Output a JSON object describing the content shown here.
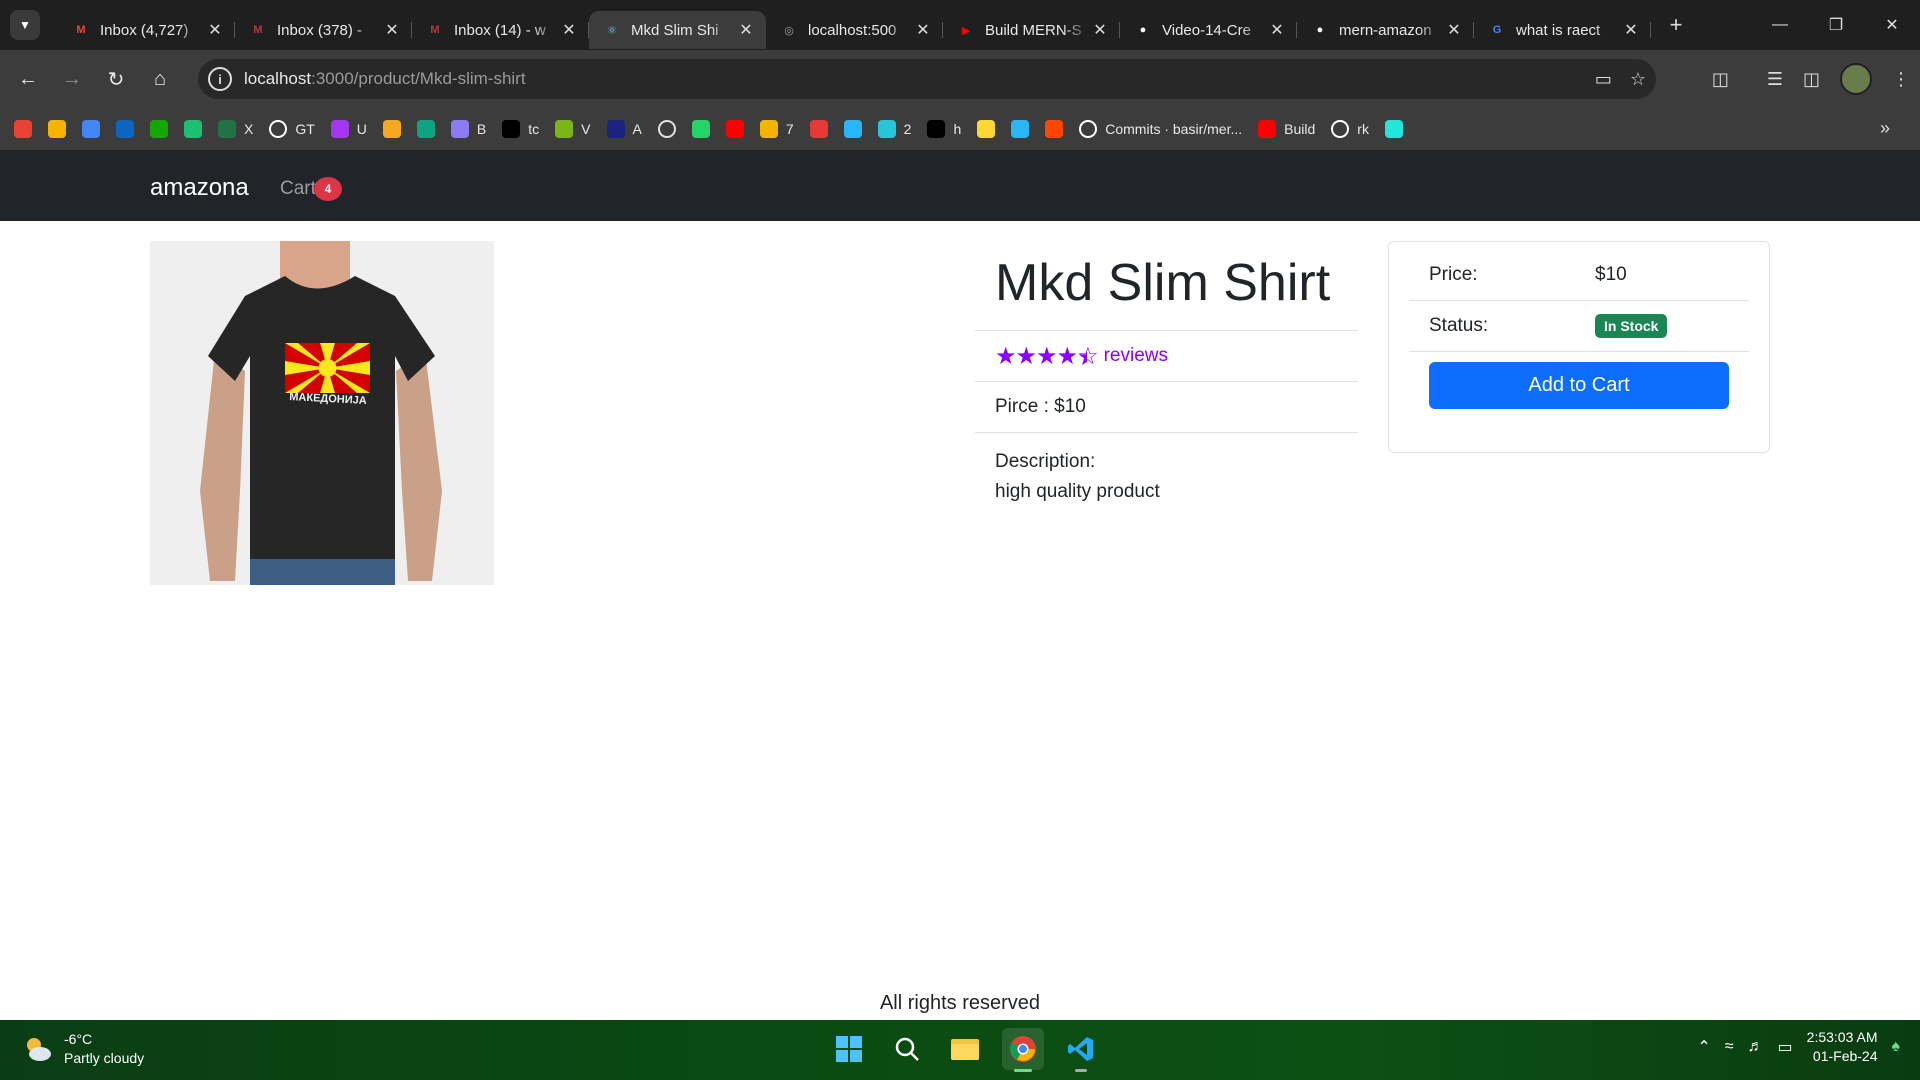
{
  "browser": {
    "tabs": [
      {
        "label": "Inbox (4,727)",
        "icon": "gmail-icon",
        "active": false
      },
      {
        "label": "Inbox (378) -",
        "icon": "mail-icon",
        "active": false
      },
      {
        "label": "Inbox (14) - w",
        "icon": "mail-icon",
        "active": false
      },
      {
        "label": "Mkd Slim Shi",
        "icon": "react-icon",
        "active": true
      },
      {
        "label": "localhost:500",
        "icon": "globe-icon",
        "active": false
      },
      {
        "label": "Build MERN-S",
        "icon": "youtube-icon",
        "active": false
      },
      {
        "label": "Video-14-Cre",
        "icon": "github-icon",
        "active": false
      },
      {
        "label": "mern-amazon",
        "icon": "github-icon",
        "active": false
      },
      {
        "label": "what is raect",
        "icon": "google-icon",
        "active": false
      }
    ],
    "url_host": "localhost",
    "url_path": ":3000/product/Mkd-slim-shirt",
    "bookmarks": [
      {
        "label": "",
        "icon": "gmail-icon",
        "color": "#ea4335"
      },
      {
        "label": "",
        "icon": "classroom-icon",
        "color": "#f4b400"
      },
      {
        "label": "",
        "icon": "drive-icon",
        "color": "#4285f4"
      },
      {
        "label": "",
        "icon": "linkedin-icon",
        "color": "#0a66c2"
      },
      {
        "label": "",
        "icon": "upwork-icon",
        "color": "#14a800"
      },
      {
        "label": "",
        "icon": "fiverr-icon",
        "color": "#1dbf73"
      },
      {
        "label": "X",
        "icon": "excel-icon",
        "color": "#217346"
      },
      {
        "label": "GT",
        "icon": "google-icon",
        "color": "#ffffff"
      },
      {
        "label": "U",
        "icon": "udemy-icon",
        "color": "#a435f0"
      },
      {
        "label": "",
        "icon": "infinity-icon",
        "color": "#f6a821"
      },
      {
        "label": "",
        "icon": "chatgpt-icon",
        "color": "#10a37f"
      },
      {
        "label": "B",
        "icon": "gemini-icon",
        "color": "#8b7cf6"
      },
      {
        "label": "tc",
        "icon": "diamond-icon",
        "color": "#000000"
      },
      {
        "label": "V",
        "icon": "download-icon",
        "color": "#7cb518"
      },
      {
        "label": "A",
        "icon": "italic-icon",
        "color": "#1a237e"
      },
      {
        "label": "",
        "icon": "circle-icon",
        "color": "#e0e0e0"
      },
      {
        "label": "",
        "icon": "whatsapp-icon",
        "color": "#25d366"
      },
      {
        "label": "",
        "icon": "youtube-icon",
        "color": "#ff0000"
      },
      {
        "label": "7",
        "icon": "play-box-icon",
        "color": "#f4b400"
      },
      {
        "label": "",
        "icon": "play-red-icon",
        "color": "#e53935"
      },
      {
        "label": "",
        "icon": "play-blue-icon",
        "color": "#29b6f6"
      },
      {
        "label": "2",
        "icon": "play-cyan-icon",
        "color": "#26c6da"
      },
      {
        "label": "h",
        "icon": "script-e-icon",
        "color": "#000000"
      },
      {
        "label": "",
        "icon": "bolt-icon",
        "color": "#fdd835"
      },
      {
        "label": "",
        "icon": "s-icon",
        "color": "#29b6f6"
      },
      {
        "label": "",
        "icon": "reddit-icon",
        "color": "#ff4500"
      },
      {
        "label": "Commits · basir/mer...",
        "icon": "github-icon",
        "color": "#ffffff"
      },
      {
        "label": "Build",
        "icon": "youtube-icon",
        "color": "#ff0000"
      },
      {
        "label": "rk",
        "icon": "github-icon",
        "color": "#ffffff"
      },
      {
        "label": "",
        "icon": "olx-icon",
        "color": "#23e5db"
      }
    ]
  },
  "site": {
    "brand": "amazona",
    "cart_label": "Cart",
    "cart_count": "4"
  },
  "product": {
    "name": "Mkd Slim Shirt",
    "rating": 4.5,
    "reviews_label": "reviews",
    "price_line": "Pirce : $10",
    "description_label": "Description:",
    "description": "high quality product",
    "image_caption": "МАКЕДОНИЈА"
  },
  "cart_card": {
    "price_label": "Price:",
    "price_value": "$10",
    "status_label": "Status:",
    "status_value": "In Stock",
    "add_button": "Add to Cart"
  },
  "footer": {
    "text": "All rights reserved"
  },
  "taskbar": {
    "temperature": "-6°C",
    "condition": "Partly cloudy",
    "time": "2:53:03 AM",
    "date": "01-Feb-24"
  },
  "colors": {
    "accent_purple": "#8b00ff",
    "button_blue": "#0d6efd",
    "stock_green": "#198754",
    "badge_red": "#dc3545",
    "navbar_dark": "#212529"
  }
}
